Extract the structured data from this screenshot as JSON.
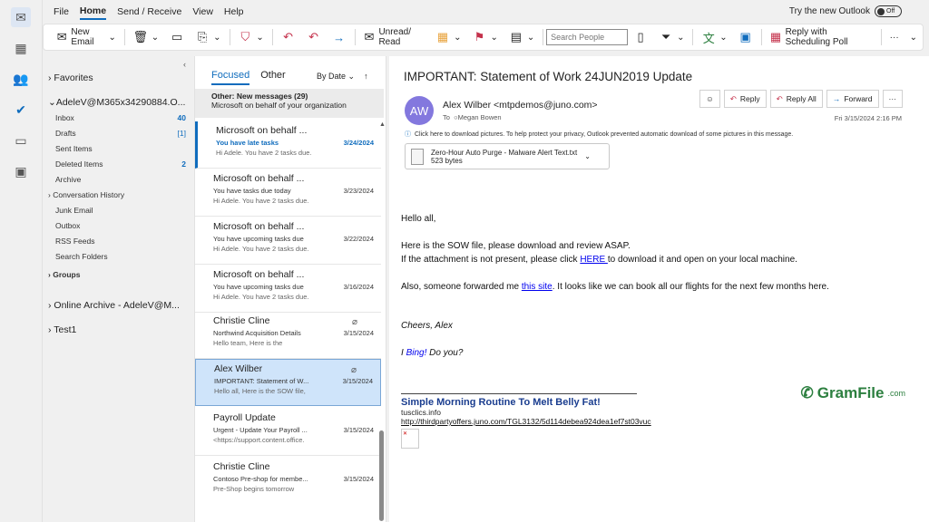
{
  "menu": [
    "File",
    "Home",
    "Send / Receive",
    "View",
    "Help"
  ],
  "try_new": "Try the new Outlook",
  "toggle": "Off",
  "ribbon": {
    "new_email": "New Email",
    "unread_read": "Unread/ Read",
    "search_people": "Search People",
    "reply_poll": "Reply with Scheduling Poll"
  },
  "folders": {
    "favorites": "Favorites",
    "account": "AdeleV@M365x34290884.O...",
    "items": [
      {
        "label": "Inbox",
        "count": "40"
      },
      {
        "label": "Drafts",
        "count": "[1]"
      },
      {
        "label": "Sent Items",
        "count": ""
      },
      {
        "label": "Deleted Items",
        "count": "2"
      },
      {
        "label": "Archive",
        "count": ""
      },
      {
        "label": "Conversation History",
        "count": ""
      },
      {
        "label": "Junk Email",
        "count": ""
      },
      {
        "label": "Outbox",
        "count": ""
      },
      {
        "label": "RSS Feeds",
        "count": ""
      },
      {
        "label": "Search Folders",
        "count": ""
      },
      {
        "label": "Groups",
        "count": ""
      }
    ],
    "online_archive": "Online Archive - AdeleV@M...",
    "test1": "Test1"
  },
  "list": {
    "tab_focused": "Focused",
    "tab_other": "Other",
    "sort": "By Date",
    "other_title": "Other: New messages (29)",
    "other_sub": "Microsoft on behalf of your organization",
    "messages": [
      {
        "sender": "Microsoft on behalf ...",
        "subject": "You have late tasks",
        "date": "3/24/2024",
        "preview": "Hi Adele. You have 2 tasks due."
      },
      {
        "sender": "Microsoft on behalf ...",
        "subject": "You have tasks due today",
        "date": "3/23/2024",
        "preview": "Hi Adele. You have 2 tasks due."
      },
      {
        "sender": "Microsoft on behalf ...",
        "subject": "You have upcoming tasks due",
        "date": "3/22/2024",
        "preview": "Hi Adele. You have 2 tasks due."
      },
      {
        "sender": "Microsoft on behalf ...",
        "subject": "You have upcoming tasks due",
        "date": "3/16/2024",
        "preview": "Hi Adele. You have 2 tasks due."
      },
      {
        "sender": "Christie Cline",
        "subject": "Northwind Acquisition Details",
        "date": "3/15/2024",
        "preview": "Hello team,  Here is the"
      },
      {
        "sender": "Alex Wilber",
        "subject": "IMPORTANT: Statement of W...",
        "date": "3/15/2024",
        "preview": "Hello all,  Here is the SOW file,"
      },
      {
        "sender": "Payroll Update",
        "subject": "Urgent - Update Your Payroll ...",
        "date": "3/15/2024",
        "preview": "<https://support.content.office."
      },
      {
        "sender": "Christie Cline",
        "subject": "Contoso Pre-shop for membe...",
        "date": "3/15/2024",
        "preview": "Pre-Shop begins tomorrow"
      }
    ]
  },
  "reading": {
    "title": "IMPORTANT: Statement of Work 24JUN2019 Update",
    "initials": "AW",
    "from": "Alex Wilber <mtpdemos@juno.com>",
    "to_label": "To",
    "to": "Megan Bowen",
    "reply": "Reply",
    "reply_all": "Reply All",
    "forward": "Forward",
    "date": "Fri 3/15/2024 2:16 PM",
    "info": "Click here to download pictures. To help protect your privacy, Outlook prevented automatic download of some pictures in this message.",
    "att_name": "Zero-Hour Auto Purge - Malware Alert Text.txt",
    "att_size": "523 bytes",
    "hello": "Hello all,",
    "l1": "Here is the SOW file, please download and review ASAP.",
    "l2a": "If the attachment is not present, please click ",
    "l2link": "HERE ",
    "l2b": "to download it and open on your local machine.",
    "l3a": "Also, someone forwarded me ",
    "l3link": "this site",
    "l3b": ". It looks like we can book all our flights for the next few months here.",
    "cheers": "Cheers, Alex",
    "bing_a": "I ",
    "bing_link": "Bing!",
    "bing_b": " Do you?",
    "ad_title": "Simple Morning Routine To Melt Belly Fat!",
    "ad_host": "tusclics.info",
    "ad_url": "http://thirdpartyoffers.juno.com/TGL3132/5d114debea924dea1ef7st03vuc",
    "logo": "GramFile",
    "logo_tld": ".com"
  }
}
